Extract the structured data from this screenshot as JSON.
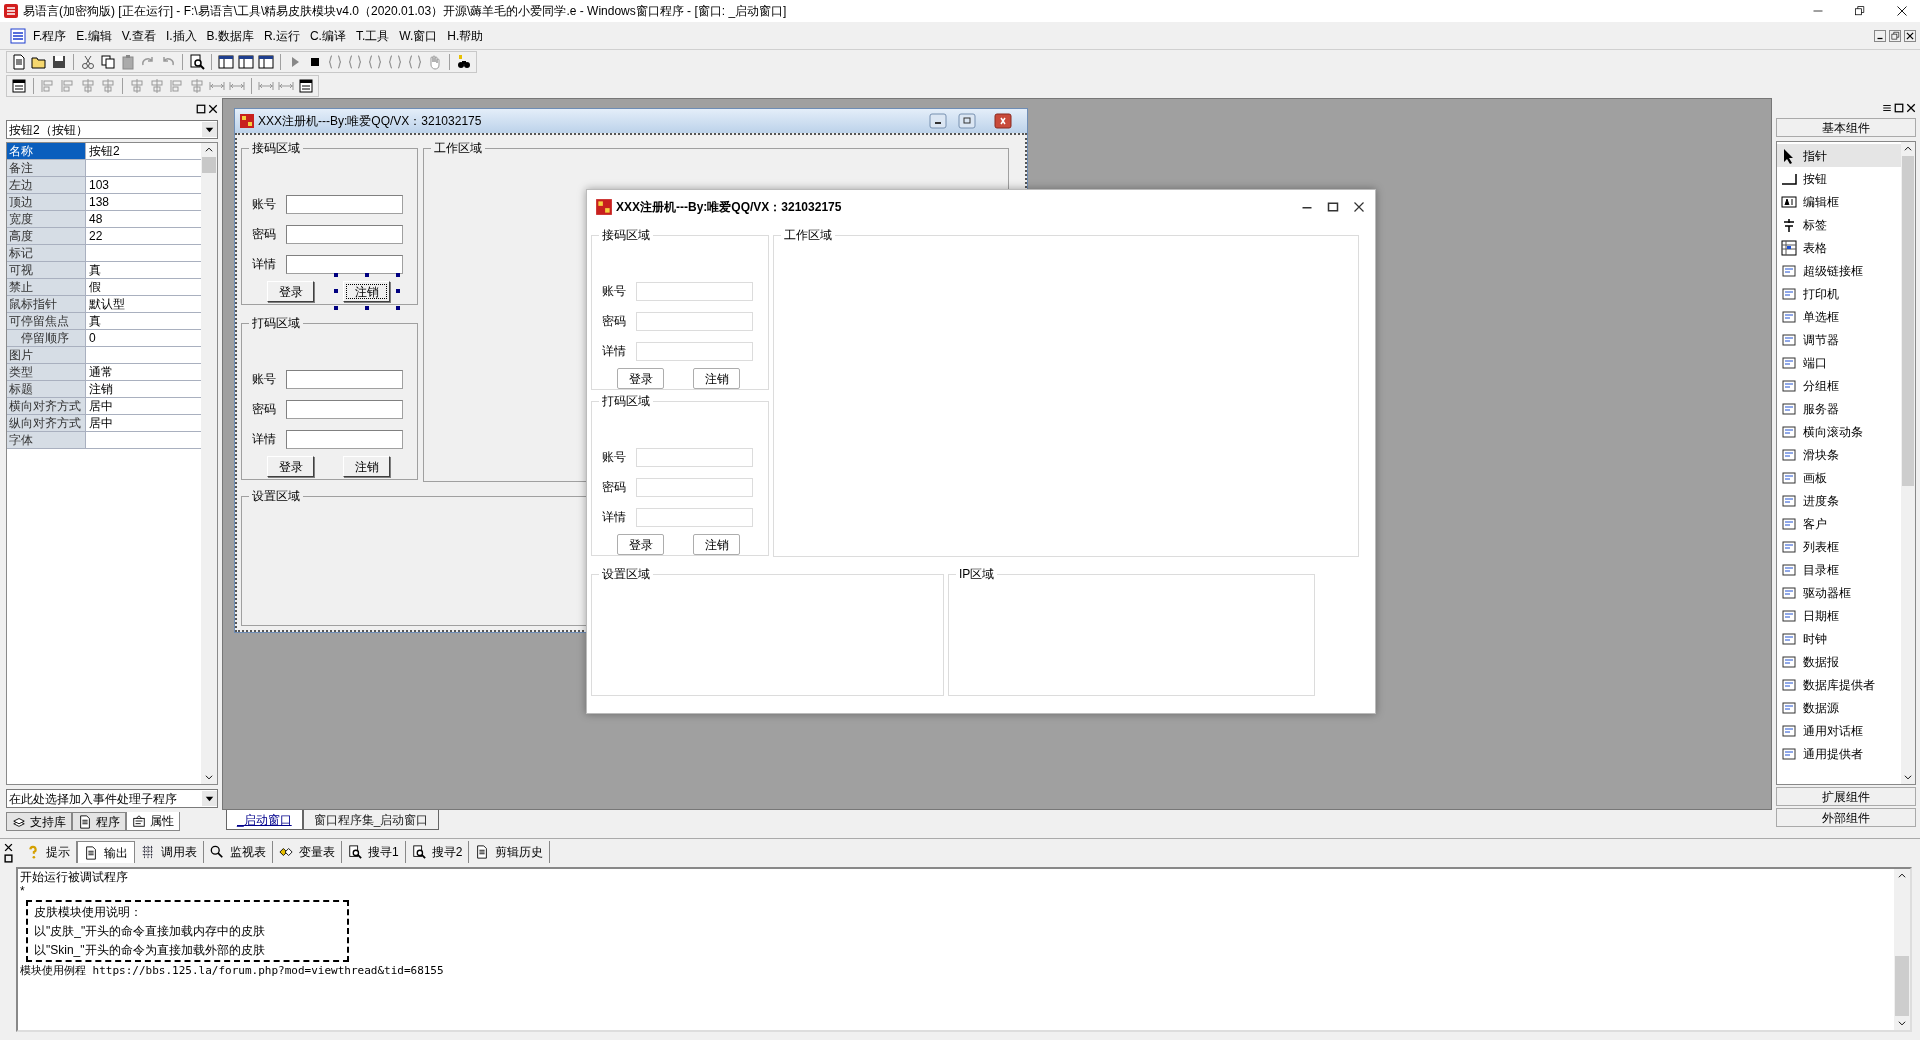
{
  "window": {
    "title": "易语言(加密狗版) [正在运行] - F:\\易语言\\工具\\精易皮肤模块v4.0（2020.01.03）开源\\薅羊毛的小爱同学.e - Windows窗口程序 - [窗口: _启动窗口]"
  },
  "menu": [
    "F.程序",
    "E.编辑",
    "V.查看",
    "I.插入",
    "B.数据库",
    "R.运行",
    "C.编译",
    "T.工具",
    "W.窗口",
    "H.帮助"
  ],
  "property_panel": {
    "object_selector": "按钮2（按钮）",
    "properties": [
      {
        "name": "名称",
        "value": "按钮2",
        "selected": true
      },
      {
        "name": "备注",
        "selected": false
      },
      {
        "name": "左边",
        "value": "103",
        "selected": false
      },
      {
        "name": "顶边",
        "value": "138",
        "selected": false
      },
      {
        "name": "宽度",
        "value": "48",
        "selected": false
      },
      {
        "name": "高度",
        "value": "22",
        "selected": false
      },
      {
        "name": "标记",
        "selected": false
      },
      {
        "name": "可视",
        "value": "真",
        "selected": false
      },
      {
        "name": "禁止",
        "value": "假",
        "selected": false
      },
      {
        "name": "鼠标指针",
        "value": "默认型",
        "selected": false
      },
      {
        "name": "可停留焦点",
        "value": "真",
        "selected": false,
        "children": [
          {
            "name": "停留顺序",
            "value": "0",
            "selected": false
          }
        ]
      },
      {
        "name": "图片",
        "selected": false
      },
      {
        "name": "类型",
        "value": "通常",
        "selected": false
      },
      {
        "name": "标题",
        "value": "注销",
        "selected": false
      },
      {
        "name": "横向对齐方式",
        "value": "居中",
        "selected": false
      },
      {
        "name": "纵向对齐方式",
        "value": "居中",
        "selected": false
      },
      {
        "name": "字体",
        "selected": false
      }
    ],
    "event_selector": "在此处选择加入事件处理子程序",
    "tabs": [
      {
        "label": "支持库",
        "selected": false
      },
      {
        "label": "程序",
        "selected": false
      },
      {
        "label": "属性",
        "selected": true
      }
    ]
  },
  "designer": {
    "title": "XXX注册机---By:唯爱QQ/VX：321032175",
    "groups": [
      {
        "title": "接码区域",
        "fields": [
          "账号",
          "密码",
          "详情"
        ],
        "buttons": [
          {
            "label": "登录",
            "selected": false
          },
          {
            "label": "注销",
            "selected": true
          }
        ]
      },
      {
        "title": "打码区域",
        "fields": [
          "账号",
          "密码",
          "详情"
        ],
        "buttons": [
          {
            "label": "登录",
            "selected": false
          },
          {
            "label": "注销",
            "selected": false
          }
        ]
      }
    ],
    "work_area": "工作区域",
    "settings_area": "设置区域"
  },
  "running_window": {
    "title": "XXX注册机---By:唯爱QQ/VX：321032175",
    "groups": [
      {
        "title": "接码区域",
        "fields": [
          "账号",
          "密码",
          "详情"
        ],
        "buttons": [
          "登录",
          "注销"
        ]
      },
      {
        "title": "打码区域",
        "fields": [
          "账号",
          "密码",
          "详情"
        ],
        "buttons": [
          "登录",
          "注销"
        ]
      }
    ],
    "work_area": "工作区域",
    "settings_area": "设置区域",
    "ip_area": "IP区域"
  },
  "editor_tabs": [
    {
      "label": "_启动窗口",
      "selected": true
    },
    {
      "label": "窗口程序集_启动窗口",
      "selected": false
    }
  ],
  "components": {
    "header": "基本组件",
    "items": [
      {
        "label": "指针",
        "selected": true
      },
      {
        "label": "按钮",
        "selected": false
      },
      {
        "label": "编辑框",
        "selected": false
      },
      {
        "label": "标签",
        "selected": false
      },
      {
        "label": "表格",
        "selected": false
      },
      {
        "label": "超级链接框",
        "selected": false
      },
      {
        "label": "打印机",
        "selected": false
      },
      {
        "label": "单选框",
        "selected": false
      },
      {
        "label": "调节器",
        "selected": false
      },
      {
        "label": "端口",
        "selected": false
      },
      {
        "label": "分组框",
        "selected": false
      },
      {
        "label": "服务器",
        "selected": false
      },
      {
        "label": "横向滚动条",
        "selected": false
      },
      {
        "label": "滑块条",
        "selected": false
      },
      {
        "label": "画板",
        "selected": false
      },
      {
        "label": "进度条",
        "selected": false
      },
      {
        "label": "客户",
        "selected": false
      },
      {
        "label": "列表框",
        "selected": false
      },
      {
        "label": "目录框",
        "selected": false
      },
      {
        "label": "驱动器框",
        "selected": false
      },
      {
        "label": "日期框",
        "selected": false
      },
      {
        "label": "时钟",
        "selected": false
      },
      {
        "label": "数据报",
        "selected": false
      },
      {
        "label": "数据库提供者",
        "selected": false
      },
      {
        "label": "数据源",
        "selected": false
      },
      {
        "label": "通用对话框",
        "selected": false
      },
      {
        "label": "通用提供者",
        "selected": false
      }
    ],
    "footer_buttons": [
      "扩展组件",
      "外部组件"
    ]
  },
  "output": {
    "tabs": [
      {
        "label": "提示",
        "selected": false
      },
      {
        "label": "输出",
        "selected": true
      },
      {
        "label": "调用表",
        "selected": false
      },
      {
        "label": "监视表",
        "selected": false
      },
      {
        "label": "变量表",
        "selected": false
      },
      {
        "label": "搜寻1",
        "selected": false
      },
      {
        "label": "搜寻2",
        "selected": false
      },
      {
        "label": "剪辑历史",
        "selected": false
      }
    ],
    "lines": [
      "开始运行被调试程序",
      "*"
    ],
    "notice": [
      "皮肤模块使用说明：",
      "以\"皮肤_\"开头的命令直接加载内存中的皮肤",
      "以\"Skin_\"开头的命令为直接加载外部的皮肤"
    ],
    "footer_line": "模块使用例程 https://bbs.125.la/forum.php?mod=viewthread&tid=68155"
  }
}
